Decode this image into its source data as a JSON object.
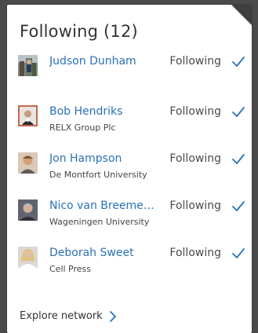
{
  "panel": {
    "title": "Following (12)",
    "explore_label": "Explore network"
  },
  "people": [
    {
      "name": "Judson Dunham",
      "org": "",
      "status": "Following"
    },
    {
      "name": "Bob Hendriks",
      "org": "RELX Group Plc",
      "status": "Following"
    },
    {
      "name": "Jon Hampson",
      "org": "De Montfort University",
      "status": "Following"
    },
    {
      "name": "Nico van Breemen...",
      "org": "Wageningen University",
      "status": "Following"
    },
    {
      "name": "Deborah Sweet",
      "org": "Cell Press",
      "status": "Following"
    }
  ],
  "colors": {
    "link": "#2a72b5",
    "check": "#2a72b5",
    "avatar_border": "#c46a4b"
  },
  "icons": {
    "check": "checkmark-icon",
    "explore": "chevron-right-icon"
  }
}
